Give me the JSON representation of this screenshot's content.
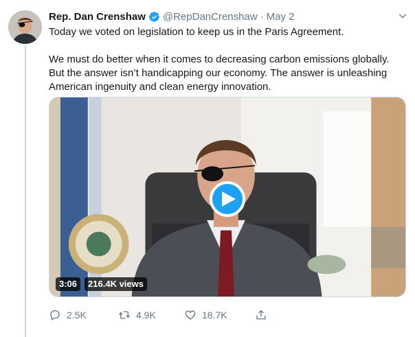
{
  "tweet": {
    "author_name": "Rep. Dan Crenshaw",
    "handle": "@RepDanCrenshaw",
    "separator": "·",
    "date": "May 2",
    "verified": true,
    "text_para1": "Today we voted on legislation to keep us in the Paris Agreement.",
    "text_para2": "We must do better when it comes to decreasing carbon emissions globally. But the answer isn’t handicapping our economy. The answer is unleashing American ingenuity and clean energy innovation."
  },
  "video": {
    "duration": "3:06",
    "views": "216.4K views"
  },
  "actions": {
    "replies": "2.5K",
    "retweets": "4.9K",
    "likes": "18.7K"
  },
  "colors": {
    "accent": "#1da1f2",
    "muted_text": "#657786",
    "thread_line": "#ccd6dd"
  },
  "icons": {
    "verified": "verified-badge-icon",
    "caret": "chevron-down-icon",
    "play": "play-icon",
    "reply": "reply-icon",
    "retweet": "retweet-icon",
    "like": "heart-icon",
    "share": "share-icon"
  }
}
